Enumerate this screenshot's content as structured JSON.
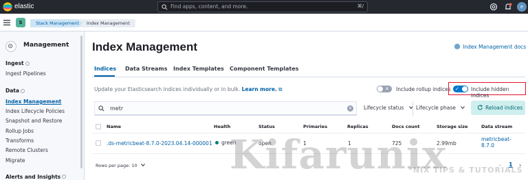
{
  "header": {
    "brand": "elastic",
    "search_placeholder": "Find apps, content, and more.",
    "search_shortcut": "⌘/",
    "avatar_initial": "e"
  },
  "breadcrumbs": {
    "app_badge": "S",
    "items": [
      "Stack Management",
      "Index Management"
    ]
  },
  "sidebar": {
    "title": "Management",
    "sections": [
      {
        "label": "Ingest",
        "items": [
          "Ingest Pipelines"
        ]
      },
      {
        "label": "Data",
        "items": [
          "Index Management",
          "Index Lifecycle Policies",
          "Snapshot and Restore",
          "Rollup Jobs",
          "Transforms",
          "Remote Clusters",
          "Migrate"
        ]
      },
      {
        "label": "Alerts and Insights",
        "items": []
      }
    ],
    "active_item": "Index Management"
  },
  "main": {
    "title": "Index Management",
    "docs_link": "Index Management docs",
    "tabs": [
      "Indices",
      "Data Streams",
      "Index Templates",
      "Component Templates"
    ],
    "active_tab": "Indices",
    "description": "Update your Elasticsearch indices individually or in bulk.",
    "learn_more": "Learn more.",
    "toggle_rollup": {
      "label": "Include rollup indices",
      "checked": false
    },
    "toggle_hidden": {
      "label": "Include hidden indices",
      "checked": true
    },
    "search_value": "metr",
    "filters": [
      "Lifecycle status",
      "Lifecycle phase"
    ],
    "reload_label": "Reload indices",
    "table": {
      "columns": [
        "Name",
        "Health",
        "Status",
        "Primaries",
        "Replicas",
        "Docs count",
        "Storage size",
        "Data stream"
      ],
      "rows": [
        {
          "name": ".ds-metricbeat-8.7.0-2023.04.14-000001",
          "health": "green",
          "status": "open",
          "primaries": "1",
          "replicas": "1",
          "docs_count": "725",
          "storage_size": "2.99mb",
          "data_stream_line1": "metricbeat-",
          "data_stream_line2": "8.7.0"
        }
      ]
    },
    "rows_per_page": "Rows per page: 10",
    "pagination": {
      "current": "1"
    }
  },
  "colors": {
    "header_bg": "#25282f",
    "primary": "#0061a6",
    "toggle_on": "#0077cc",
    "highlight_box": "#e0112b",
    "health_green": "#017d73",
    "reload_bg": "#cfeeee"
  },
  "watermark": {
    "main": "Kifarunix",
    "tagline": "*NIX TIPS & TUTORIALS"
  }
}
